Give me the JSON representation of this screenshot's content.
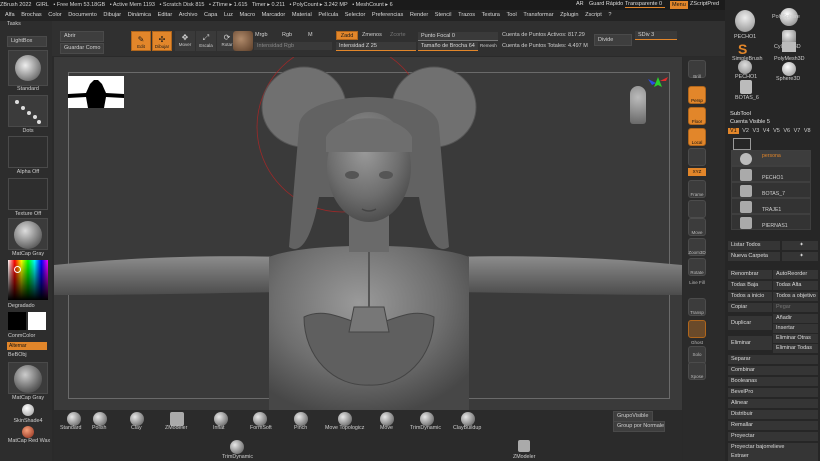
{
  "titlebar": {
    "items": [
      "ZBrush 2022",
      "GIRL",
      "• Free Mem 53.18GB",
      "• Active Mem 1193",
      "• Scratch Disk 815",
      "• ZTime ▸ 1.615",
      "Timer ▸ 0.211",
      "• PolyCount ▸ 3.242 MP",
      "• MeshCount ▸ 6"
    ],
    "ar": "AR",
    "guard": "Guard Rápido",
    "transparente": "Transparente 0",
    "menu": "Menu",
    "zscript": "ZScriptPred"
  },
  "menubar": {
    "items": [
      "Tasks",
      "Alfa",
      "Brochas",
      "Color",
      "Documento",
      "Dibujar",
      "Dinámica",
      "Editar",
      "Archivo",
      "Capa",
      "Luz",
      "Macro",
      "Marcador",
      "Material",
      "Película",
      "Selector",
      "Preferencias",
      "Render",
      "Stencil",
      "Trazos",
      "Textura",
      "Tool",
      "Transformar",
      "Zplugin",
      "Zscript",
      "?"
    ]
  },
  "shelf": {
    "abrir": "Abrir",
    "guardar": "Guardar Como",
    "edit": "Edit",
    "draw": "Dibujar",
    "move": "Mover",
    "scale": "Escala",
    "rotate": "Rotar",
    "mrgb": "Mrgb",
    "rgb": "Rgb",
    "m": "M",
    "zadd": "Zadd",
    "zsub": "Zmenos",
    "zcut": "Zcorte",
    "intensidad_rgb": "Intensidad Rgb",
    "intensidad_z": "Intensidad Z 25",
    "punto_focal": "Punto Focal 0",
    "tamano": "Tamaño de Brocha 64",
    "remesh": "Remesh",
    "puntos_activos": "Cuenta de Puntos Activos: 817.29",
    "puntos_totales": "Cuenta de Puntos Totales: 4.497 M",
    "divide": "Divide",
    "sdiv": "SDiv 3"
  },
  "leftpanel": {
    "title": "Tasks",
    "lightbox": "LightBox",
    "standard": "Standard",
    "dots": "Dots",
    "alpha_off": "Alpha Off",
    "texture_off": "Texture Off",
    "matcap_gray": "MatCap Gray",
    "degradado": "Degradado",
    "switch_color": "ConmColor",
    "alternar": "Alternar",
    "bebbj": "BeBObj",
    "matcap_gray2": "MatCap Gray",
    "skinshade": "SkinShade4",
    "matcap_red": "MatCap Red Wax"
  },
  "rightstrip": {
    "items": [
      "Brill",
      "Persp",
      "Floor",
      "Local",
      "XYZ",
      "Frame",
      "Move",
      "Zoom3D",
      "Rotate",
      "Line Fill",
      "Transp",
      "Ghost",
      "Solo",
      "Xpose"
    ]
  },
  "tray": {
    "tool_thumbs": [
      "PECHO1",
      "PolySphere",
      "SimpleBrush",
      "Cylinder3D",
      "PECHO1",
      "PolyMesh3D",
      "BOTAS_6",
      "Sphere3D"
    ],
    "subtool_title": "SubTool",
    "visible_count": "Cuenta Visible 5",
    "v_tabs": [
      "V1",
      "V2",
      "V3",
      "V4",
      "V5",
      "V6",
      "V7",
      "V8"
    ],
    "subtools": [
      "persona",
      "PECHO1",
      "BOTAS_7",
      "TRAJE1",
      "PIERNAS1"
    ],
    "lista_todos": "Listar Todos",
    "nueva_carpeta": "Nueva Carpeta",
    "renombrar": "Renombrar",
    "autoreorder": "AutoReorder",
    "todas_baja": "Todas Baja",
    "todas_alta": "Todas Alta",
    "todos_inicio": "Todos a inicio",
    "todos_objetivo": "Todos a objetivo",
    "copiar": "Copiar",
    "pegar": "Pegar",
    "duplicar": "Duplicar",
    "anadir": "Añadir",
    "insertar": "Insertar",
    "eliminar": "Eliminar",
    "eliminar_otras": "Eliminar Otras",
    "eliminar_todas": "Eliminar Todas",
    "list": [
      "Separar",
      "Combinar",
      "Booleanas",
      "BevelPro",
      "Alinear",
      "Distribuir",
      "Remallar",
      "Proyectar",
      "Proyectar bajorrelieve",
      "Extraer"
    ]
  },
  "bottom": {
    "brushes": [
      "Standard",
      "Polish",
      "Clay",
      "ZModeler",
      "Inflat",
      "FormSoft",
      "Pinch",
      "Move Topologicz",
      "Move",
      "TrimDynamic",
      "ClayBuildup"
    ],
    "row2": [
      "TrimDynamic",
      "ZModeler"
    ],
    "grupo_visible": "GrupoVisible",
    "grupo_normales": "Group por Normales"
  },
  "colors": {
    "accent": "#e2862a",
    "bg": "#2a2a2a"
  }
}
